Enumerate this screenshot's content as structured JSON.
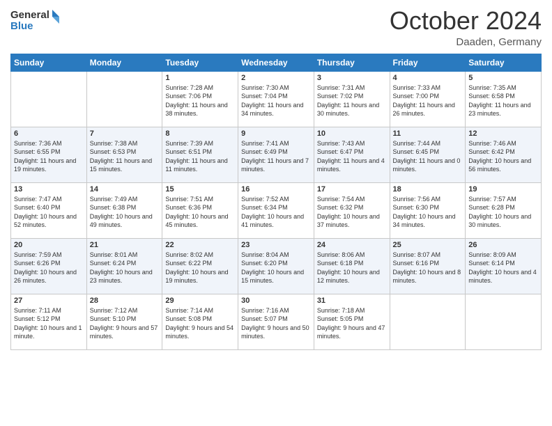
{
  "header": {
    "logo_line1": "General",
    "logo_line2": "Blue",
    "month_title": "October 2024",
    "location": "Daaden, Germany"
  },
  "weekdays": [
    "Sunday",
    "Monday",
    "Tuesday",
    "Wednesday",
    "Thursday",
    "Friday",
    "Saturday"
  ],
  "weeks": [
    [
      {
        "day": "",
        "sunrise": "",
        "sunset": "",
        "daylight": ""
      },
      {
        "day": "",
        "sunrise": "",
        "sunset": "",
        "daylight": ""
      },
      {
        "day": "1",
        "sunrise": "Sunrise: 7:28 AM",
        "sunset": "Sunset: 7:06 PM",
        "daylight": "Daylight: 11 hours and 38 minutes."
      },
      {
        "day": "2",
        "sunrise": "Sunrise: 7:30 AM",
        "sunset": "Sunset: 7:04 PM",
        "daylight": "Daylight: 11 hours and 34 minutes."
      },
      {
        "day": "3",
        "sunrise": "Sunrise: 7:31 AM",
        "sunset": "Sunset: 7:02 PM",
        "daylight": "Daylight: 11 hours and 30 minutes."
      },
      {
        "day": "4",
        "sunrise": "Sunrise: 7:33 AM",
        "sunset": "Sunset: 7:00 PM",
        "daylight": "Daylight: 11 hours and 26 minutes."
      },
      {
        "day": "5",
        "sunrise": "Sunrise: 7:35 AM",
        "sunset": "Sunset: 6:58 PM",
        "daylight": "Daylight: 11 hours and 23 minutes."
      }
    ],
    [
      {
        "day": "6",
        "sunrise": "Sunrise: 7:36 AM",
        "sunset": "Sunset: 6:55 PM",
        "daylight": "Daylight: 11 hours and 19 minutes."
      },
      {
        "day": "7",
        "sunrise": "Sunrise: 7:38 AM",
        "sunset": "Sunset: 6:53 PM",
        "daylight": "Daylight: 11 hours and 15 minutes."
      },
      {
        "day": "8",
        "sunrise": "Sunrise: 7:39 AM",
        "sunset": "Sunset: 6:51 PM",
        "daylight": "Daylight: 11 hours and 11 minutes."
      },
      {
        "day": "9",
        "sunrise": "Sunrise: 7:41 AM",
        "sunset": "Sunset: 6:49 PM",
        "daylight": "Daylight: 11 hours and 7 minutes."
      },
      {
        "day": "10",
        "sunrise": "Sunrise: 7:43 AM",
        "sunset": "Sunset: 6:47 PM",
        "daylight": "Daylight: 11 hours and 4 minutes."
      },
      {
        "day": "11",
        "sunrise": "Sunrise: 7:44 AM",
        "sunset": "Sunset: 6:45 PM",
        "daylight": "Daylight: 11 hours and 0 minutes."
      },
      {
        "day": "12",
        "sunrise": "Sunrise: 7:46 AM",
        "sunset": "Sunset: 6:42 PM",
        "daylight": "Daylight: 10 hours and 56 minutes."
      }
    ],
    [
      {
        "day": "13",
        "sunrise": "Sunrise: 7:47 AM",
        "sunset": "Sunset: 6:40 PM",
        "daylight": "Daylight: 10 hours and 52 minutes."
      },
      {
        "day": "14",
        "sunrise": "Sunrise: 7:49 AM",
        "sunset": "Sunset: 6:38 PM",
        "daylight": "Daylight: 10 hours and 49 minutes."
      },
      {
        "day": "15",
        "sunrise": "Sunrise: 7:51 AM",
        "sunset": "Sunset: 6:36 PM",
        "daylight": "Daylight: 10 hours and 45 minutes."
      },
      {
        "day": "16",
        "sunrise": "Sunrise: 7:52 AM",
        "sunset": "Sunset: 6:34 PM",
        "daylight": "Daylight: 10 hours and 41 minutes."
      },
      {
        "day": "17",
        "sunrise": "Sunrise: 7:54 AM",
        "sunset": "Sunset: 6:32 PM",
        "daylight": "Daylight: 10 hours and 37 minutes."
      },
      {
        "day": "18",
        "sunrise": "Sunrise: 7:56 AM",
        "sunset": "Sunset: 6:30 PM",
        "daylight": "Daylight: 10 hours and 34 minutes."
      },
      {
        "day": "19",
        "sunrise": "Sunrise: 7:57 AM",
        "sunset": "Sunset: 6:28 PM",
        "daylight": "Daylight: 10 hours and 30 minutes."
      }
    ],
    [
      {
        "day": "20",
        "sunrise": "Sunrise: 7:59 AM",
        "sunset": "Sunset: 6:26 PM",
        "daylight": "Daylight: 10 hours and 26 minutes."
      },
      {
        "day": "21",
        "sunrise": "Sunrise: 8:01 AM",
        "sunset": "Sunset: 6:24 PM",
        "daylight": "Daylight: 10 hours and 23 minutes."
      },
      {
        "day": "22",
        "sunrise": "Sunrise: 8:02 AM",
        "sunset": "Sunset: 6:22 PM",
        "daylight": "Daylight: 10 hours and 19 minutes."
      },
      {
        "day": "23",
        "sunrise": "Sunrise: 8:04 AM",
        "sunset": "Sunset: 6:20 PM",
        "daylight": "Daylight: 10 hours and 15 minutes."
      },
      {
        "day": "24",
        "sunrise": "Sunrise: 8:06 AM",
        "sunset": "Sunset: 6:18 PM",
        "daylight": "Daylight: 10 hours and 12 minutes."
      },
      {
        "day": "25",
        "sunrise": "Sunrise: 8:07 AM",
        "sunset": "Sunset: 6:16 PM",
        "daylight": "Daylight: 10 hours and 8 minutes."
      },
      {
        "day": "26",
        "sunrise": "Sunrise: 8:09 AM",
        "sunset": "Sunset: 6:14 PM",
        "daylight": "Daylight: 10 hours and 4 minutes."
      }
    ],
    [
      {
        "day": "27",
        "sunrise": "Sunrise: 7:11 AM",
        "sunset": "Sunset: 5:12 PM",
        "daylight": "Daylight: 10 hours and 1 minute."
      },
      {
        "day": "28",
        "sunrise": "Sunrise: 7:12 AM",
        "sunset": "Sunset: 5:10 PM",
        "daylight": "Daylight: 9 hours and 57 minutes."
      },
      {
        "day": "29",
        "sunrise": "Sunrise: 7:14 AM",
        "sunset": "Sunset: 5:08 PM",
        "daylight": "Daylight: 9 hours and 54 minutes."
      },
      {
        "day": "30",
        "sunrise": "Sunrise: 7:16 AM",
        "sunset": "Sunset: 5:07 PM",
        "daylight": "Daylight: 9 hours and 50 minutes."
      },
      {
        "day": "31",
        "sunrise": "Sunrise: 7:18 AM",
        "sunset": "Sunset: 5:05 PM",
        "daylight": "Daylight: 9 hours and 47 minutes."
      },
      {
        "day": "",
        "sunrise": "",
        "sunset": "",
        "daylight": ""
      },
      {
        "day": "",
        "sunrise": "",
        "sunset": "",
        "daylight": ""
      }
    ]
  ]
}
